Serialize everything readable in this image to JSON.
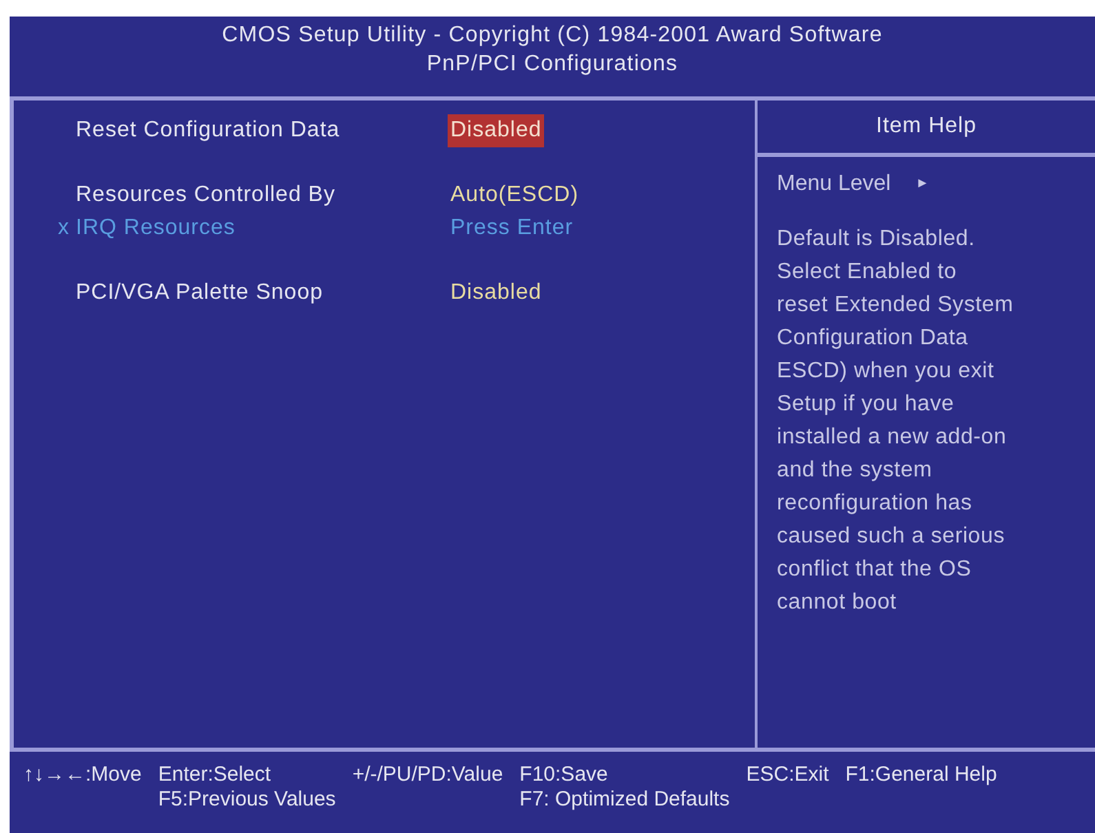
{
  "header": {
    "title": "CMOS Setup Utility - Copyright (C) 1984-2001 Award Software",
    "subtitle": "PnP/PCI Configurations"
  },
  "settings": [
    {
      "kind": "setting",
      "label": "Reset Configuration Data",
      "value": "Disabled",
      "selected": true
    },
    {
      "kind": "setting",
      "label": "Resources Controlled By",
      "value": "Auto(ESCD)",
      "selected": false
    },
    {
      "kind": "submenu",
      "marker": "x",
      "label": "IRQ Resources",
      "value": "Press Enter",
      "selected": false
    },
    {
      "kind": "setting",
      "label": "PCI/VGA Palette Snoop",
      "value": "Disabled",
      "selected": false
    }
  ],
  "help": {
    "title": "Item Help",
    "menu_level": "Menu Level",
    "menu_level_arrow": "►",
    "lines": [
      "Default is Disabled.",
      "Select Enabled to",
      "reset Extended System",
      "Configuration Data",
      "ESCD) when you exit",
      "Setup if you have",
      "installed a new add-on",
      "and the system",
      "reconfiguration has",
      "caused such a serious",
      "conflict that the OS",
      "cannot boot"
    ]
  },
  "footer": {
    "rows": [
      [
        "↑↓→←:Move",
        "Enter:Select",
        "+/-/PU/PD:Value",
        "F10:Save",
        "ESC:Exit",
        "F1:General Help"
      ],
      [
        "",
        "F5:Previous Values",
        "",
        "F7: Optimized Defaults"
      ]
    ]
  }
}
